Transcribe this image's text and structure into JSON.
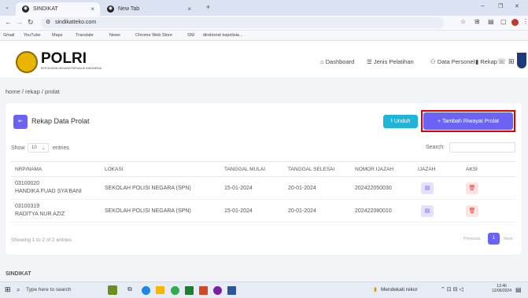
{
  "tabs": [
    {
      "label": "SINDIKAT",
      "close": "×"
    },
    {
      "label": "New Tab",
      "close": "×"
    }
  ],
  "new_tab": "+",
  "window_controls": {
    "min": "–",
    "max": "❐",
    "close": "✕"
  },
  "url": "sindikatteko.com",
  "bookmarks": [
    "Gmail",
    "YouTube",
    "Maps",
    "Translate",
    "News",
    "Chrome Web Store",
    "SNI",
    "direktorat kepolisia..."
  ],
  "brand": {
    "name": "POLRI",
    "subtitle": "KEPOLISIAN NEGARA REPUBLIK INDONESIA"
  },
  "nav": [
    "Dashboard",
    "Jenis Pelatihan",
    "Data Personel",
    "Rekap"
  ],
  "breadcrumb": "home / rekap / prolat",
  "card": {
    "title": "Rekap Data Prolat",
    "back": "⇤",
    "unduh": "Unduh",
    "tambah": "+ Tambah Riwayat Prolat",
    "show": "Show",
    "show_value": "10",
    "entries": "entries",
    "search_label": "Search:",
    "columns": [
      "NRP/NAMA",
      "LOKASI",
      "TANGGAL MULAI",
      "TANGGAL SELESAI",
      "NOMOR IJAZAH",
      "IJAZAH",
      "AKSI"
    ],
    "rows": [
      {
        "nrp": "03100020",
        "nama": "HANDIKA FUAD SYA'BANI",
        "lokasi": "SEKOLAH POLISI NEGARA (SPN)",
        "mulai": "15-01-2024",
        "selesai": "20-01-2024",
        "ijazah": "202422050030"
      },
      {
        "nrp": "03100319",
        "nama": "RADITYA NUR AZIZ",
        "lokasi": "SEKOLAH POLISI NEGARA (SPN)",
        "mulai": "15-01-2024",
        "selesai": "20-01-2024",
        "ijazah": "202422080010"
      }
    ],
    "info": "Showing 1 to 2 of 2 entries",
    "prev": "Previous",
    "page": "1",
    "next": "Next"
  },
  "footer_brand": "SINDIKAT",
  "taskbar": {
    "search": "Type here to search",
    "notif": "Mendekati rekor",
    "time": "13:46",
    "date": "12/06/2024"
  },
  "colors": {
    "primary": "#6c63f5",
    "teal": "#1fb5d6",
    "highlight": "#e00000",
    "danger": "#ff6b6b"
  }
}
